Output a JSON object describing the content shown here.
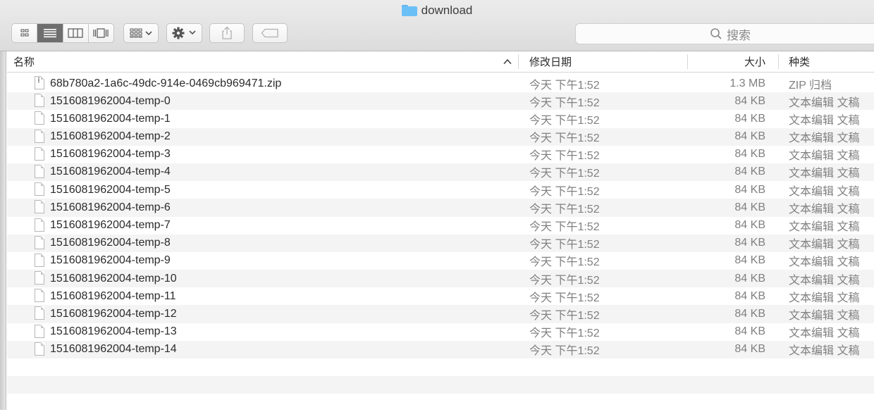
{
  "window": {
    "title": "download"
  },
  "toolbar": {
    "view_buttons": [
      "icon-view-icon",
      "list-view-icon",
      "column-view-icon",
      "cover-flow-icon"
    ],
    "search_placeholder": "搜索"
  },
  "columns": {
    "name": "名称",
    "date": "修改日期",
    "size": "大小",
    "kind": "种类"
  },
  "files": [
    {
      "name": "68b780a2-1a6c-49dc-914e-0469cb969471.zip",
      "date": "今天 下午1:52",
      "size": "1.3 MB",
      "kind": "ZIP 归档"
    },
    {
      "name": "1516081962004-temp-0",
      "date": "今天 下午1:52",
      "size": "84 KB",
      "kind": "文本编辑 文稿"
    },
    {
      "name": "1516081962004-temp-1",
      "date": "今天 下午1:52",
      "size": "84 KB",
      "kind": "文本编辑 文稿"
    },
    {
      "name": "1516081962004-temp-2",
      "date": "今天 下午1:52",
      "size": "84 KB",
      "kind": "文本编辑 文稿"
    },
    {
      "name": "1516081962004-temp-3",
      "date": "今天 下午1:52",
      "size": "84 KB",
      "kind": "文本编辑 文稿"
    },
    {
      "name": "1516081962004-temp-4",
      "date": "今天 下午1:52",
      "size": "84 KB",
      "kind": "文本编辑 文稿"
    },
    {
      "name": "1516081962004-temp-5",
      "date": "今天 下午1:52",
      "size": "84 KB",
      "kind": "文本编辑 文稿"
    },
    {
      "name": "1516081962004-temp-6",
      "date": "今天 下午1:52",
      "size": "84 KB",
      "kind": "文本编辑 文稿"
    },
    {
      "name": "1516081962004-temp-7",
      "date": "今天 下午1:52",
      "size": "84 KB",
      "kind": "文本编辑 文稿"
    },
    {
      "name": "1516081962004-temp-8",
      "date": "今天 下午1:52",
      "size": "84 KB",
      "kind": "文本编辑 文稿"
    },
    {
      "name": "1516081962004-temp-9",
      "date": "今天 下午1:52",
      "size": "84 KB",
      "kind": "文本编辑 文稿"
    },
    {
      "name": "1516081962004-temp-10",
      "date": "今天 下午1:52",
      "size": "84 KB",
      "kind": "文本编辑 文稿"
    },
    {
      "name": "1516081962004-temp-11",
      "date": "今天 下午1:52",
      "size": "84 KB",
      "kind": "文本编辑 文稿"
    },
    {
      "name": "1516081962004-temp-12",
      "date": "今天 下午1:52",
      "size": "84 KB",
      "kind": "文本编辑 文稿"
    },
    {
      "name": "1516081962004-temp-13",
      "date": "今天 下午1:52",
      "size": "84 KB",
      "kind": "文本编辑 文稿"
    },
    {
      "name": "1516081962004-temp-14",
      "date": "今天 下午1:52",
      "size": "84 KB",
      "kind": "文本编辑 文稿"
    }
  ]
}
